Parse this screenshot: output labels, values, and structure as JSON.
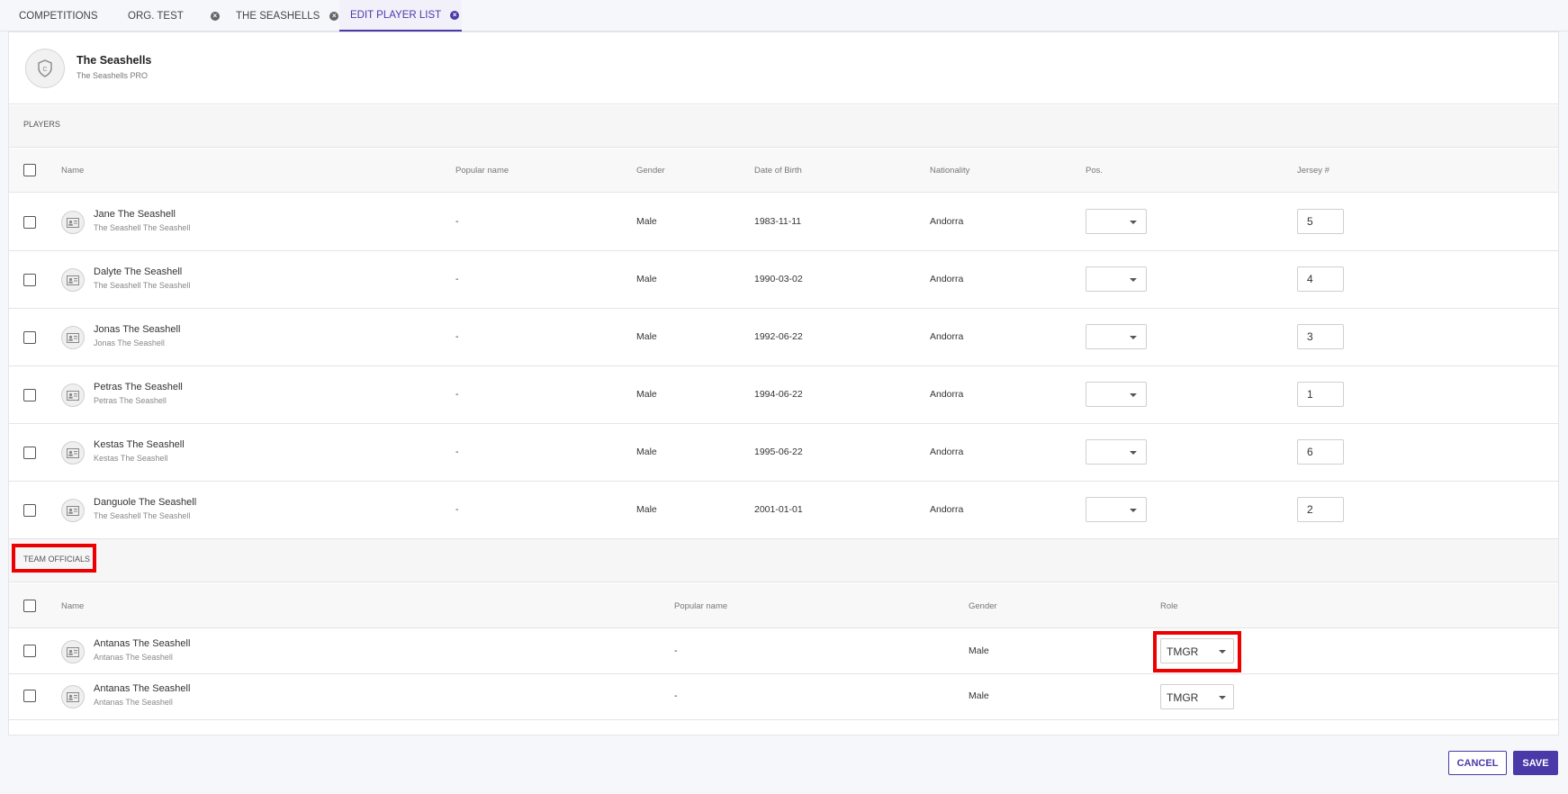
{
  "tabs": [
    {
      "label": "COMPETITIONS",
      "closable": false,
      "active": false
    },
    {
      "label": "ORG. TEST",
      "closable": true,
      "active": false
    },
    {
      "label": "THE SEASHELLS",
      "closable": true,
      "active": false
    },
    {
      "label": "EDIT PLAYER LIST",
      "closable": true,
      "active": true
    }
  ],
  "team": {
    "name": "The Seashells",
    "subtitle": "The Seashells PRO"
  },
  "players": {
    "section_label": "PLAYERS",
    "headers": {
      "name": "Name",
      "popular_name": "Popular name",
      "gender": "Gender",
      "dob": "Date of Birth",
      "nationality": "Nationality",
      "position": "Pos.",
      "jersey": "Jersey #"
    },
    "rows": [
      {
        "name": "Jane The Seashell",
        "sub": "The Seashell The Seashell",
        "popular": "-",
        "gender": "Male",
        "dob": "1983-11-11",
        "nationality": "Andorra",
        "position": "",
        "jersey": "5"
      },
      {
        "name": "Dalyte The Seashell",
        "sub": "The Seashell The Seashell",
        "popular": "-",
        "gender": "Male",
        "dob": "1990-03-02",
        "nationality": "Andorra",
        "position": "",
        "jersey": "4"
      },
      {
        "name": "Jonas The Seashell",
        "sub": "Jonas The Seashell",
        "popular": "-",
        "gender": "Male",
        "dob": "1992-06-22",
        "nationality": "Andorra",
        "position": "",
        "jersey": "3"
      },
      {
        "name": "Petras The Seashell",
        "sub": "Petras The Seashell",
        "popular": "-",
        "gender": "Male",
        "dob": "1994-06-22",
        "nationality": "Andorra",
        "position": "",
        "jersey": "1"
      },
      {
        "name": "Kestas The Seashell",
        "sub": "Kestas The Seashell",
        "popular": "-",
        "gender": "Male",
        "dob": "1995-06-22",
        "nationality": "Andorra",
        "position": "",
        "jersey": "6"
      },
      {
        "name": "Danguole The Seashell",
        "sub": "The Seashell The Seashell",
        "popular": "-",
        "gender": "Male",
        "dob": "2001-01-01",
        "nationality": "Andorra",
        "position": "",
        "jersey": "2"
      }
    ]
  },
  "officials": {
    "section_label": "TEAM OFFICIALS",
    "headers": {
      "name": "Name",
      "popular_name": "Popular name",
      "gender": "Gender",
      "role": "Role"
    },
    "rows": [
      {
        "name": "Antanas The Seashell",
        "sub": "Antanas The Seashell",
        "popular": "-",
        "gender": "Male",
        "role": "TMGR"
      },
      {
        "name": "Antanas The Seashell",
        "sub": "Antanas The Seashell",
        "popular": "-",
        "gender": "Male",
        "role": "TMGR"
      }
    ]
  },
  "actions": {
    "cancel": "CANCEL",
    "save": "SAVE"
  },
  "colors": {
    "accent": "#4a3aa9",
    "highlight": "#ee0000"
  },
  "icons": {
    "tab_close": "close-circle-icon",
    "team_logo": "shield-icon",
    "player_avatar": "id-card-icon",
    "dropdown": "caret-down-icon"
  }
}
